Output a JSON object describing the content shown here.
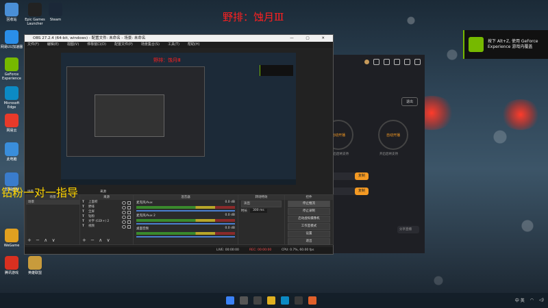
{
  "overlay": {
    "top_title": "野排：蚀月Ⅲ",
    "left_title": "钻粉一对一指导"
  },
  "desktop_icons": [
    {
      "label": "回收站",
      "icon": "recycle-bin-icon",
      "color": "#4a8fd6"
    },
    {
      "label": "Epic Games Launcher",
      "icon": "epic-icon",
      "color": "#222222"
    },
    {
      "label": "Steam",
      "icon": "steam-icon",
      "color": "#1b2838"
    },
    {
      "label": "网易UU加速器",
      "icon": "uu-icon",
      "color": "#2a8ee8"
    },
    {
      "label": "GeForce Experience",
      "icon": "nvidia-icon",
      "color": "#76b900"
    },
    {
      "label": "Microsoft Edge",
      "icon": "edge-icon",
      "color": "#0c8ac4"
    },
    {
      "label": "网易云",
      "icon": "app-icon",
      "color": "#e83a2a"
    },
    {
      "label": "此电脑",
      "icon": "computer-icon",
      "color": "#3a8edb"
    },
    {
      "label": "控制面板",
      "icon": "control-panel-icon",
      "color": "#3a7ccc"
    },
    {
      "label": "WeGame",
      "icon": "wegame-icon",
      "color": "#e0a020"
    },
    {
      "label": "腾讯游戏",
      "icon": "tencent-icon",
      "color": "#d83020"
    },
    {
      "label": "英雄联盟",
      "icon": "lol-icon",
      "color": "#c89b3c"
    },
    {
      "label": "The Finals",
      "icon": "game-icon",
      "color": "#c22828"
    }
  ],
  "toast": {
    "text": "按下 Alt+Z, 使用 GeForce Experience 游戏内覆盖"
  },
  "obs": {
    "title": "OBS 27.2.4 (64-bit, windows) - 配置文件: 未命名 - 场景: 未命名",
    "menu": [
      "文件(F)",
      "编辑(E)",
      "视图(V)",
      "停靠窗口(D)",
      "配置文件(P)",
      "场景集合(S)",
      "工具(T)",
      "帮助(H)"
    ],
    "preview_overlay": "野排：蚀月Ⅲ",
    "dock_headers": {
      "scenes": "场景",
      "sources": "来源",
      "mixer": "混音器",
      "transitions": "转场特效",
      "controls": "控件"
    },
    "scene_item": "场景",
    "sources": [
      {
        "label": "上面积"
      },
      {
        "label": "野排"
      },
      {
        "label": "全屏"
      },
      {
        "label": "钻粉"
      },
      {
        "label": "文字 (GDI+) 2"
      },
      {
        "label": "视频"
      }
    ],
    "mixer": [
      {
        "name": "麦克风/Aux",
        "level": "0.0 dB"
      },
      {
        "name": "麦克风/Aux 2",
        "level": "0.0 dB"
      },
      {
        "name": "桌面音频",
        "level": "0.0 dB"
      }
    ],
    "transition": {
      "type": "淡出",
      "duration_label": "时长",
      "duration": "300 ms"
    },
    "controls": [
      "停止推流",
      "停止录制",
      "启动虚拟摄像机",
      "工作室模式",
      "设置",
      "退出"
    ],
    "status": {
      "live": "LIVE: 00:00:00",
      "rec": "REC: 00:00:00",
      "cpu": "CPU: 0.7%, 60.00 fps"
    },
    "tools": "+ − ∧ ∨"
  },
  "app": {
    "exit_label": "退出",
    "left_circle": "自动开播",
    "right_circle": "自动开播",
    "sub_left": "开启后将支持",
    "sub_right": "开启后将支持",
    "btn1": "复制",
    "btn2": "复制",
    "bottom_btn": "分享直播"
  },
  "taskbar": {
    "time": "",
    "tray": "中 英"
  }
}
